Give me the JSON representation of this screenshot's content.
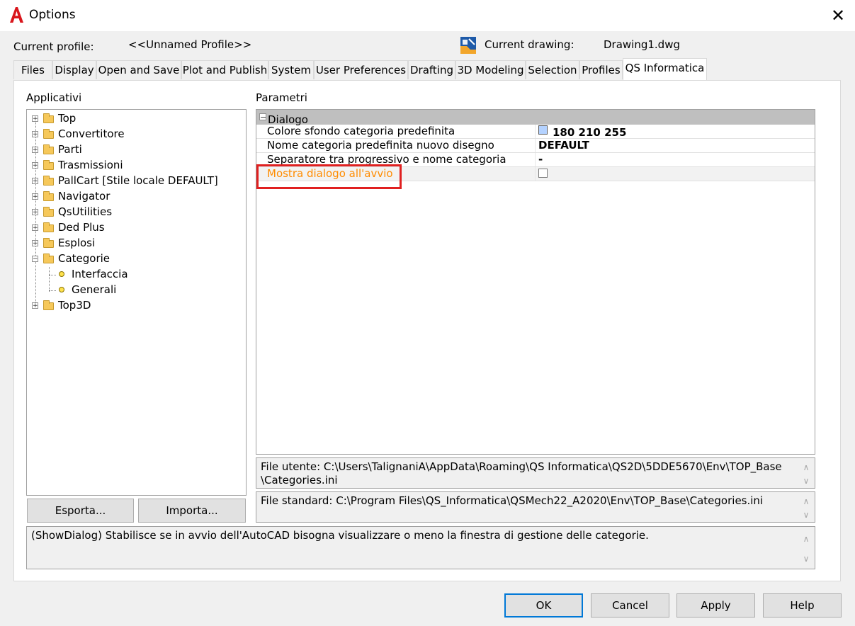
{
  "window": {
    "title": "Options",
    "close_glyph": "✕",
    "logo_letter": "A"
  },
  "profile": {
    "label": "Current profile:",
    "value": "<<Unnamed Profile>>"
  },
  "drawing": {
    "label": "Current drawing:",
    "value": "Drawing1.dwg"
  },
  "tabs": [
    {
      "label": "Files"
    },
    {
      "label": "Display"
    },
    {
      "label": "Open and Save"
    },
    {
      "label": "Plot and Publish"
    },
    {
      "label": "System"
    },
    {
      "label": "User Preferences"
    },
    {
      "label": "Drafting"
    },
    {
      "label": "3D Modeling"
    },
    {
      "label": "Selection"
    },
    {
      "label": "Profiles"
    },
    {
      "label": "QS Informatica"
    }
  ],
  "left": {
    "heading": "Applicativi",
    "tree": [
      {
        "label": "Top"
      },
      {
        "label": "Convertitore"
      },
      {
        "label": "Parti"
      },
      {
        "label": "Trasmissioni"
      },
      {
        "label": "PallCart [Stile locale DEFAULT]"
      },
      {
        "label": "Navigator"
      },
      {
        "label": "QsUtilities"
      },
      {
        "label": "Ded Plus"
      },
      {
        "label": "Esplosi"
      },
      {
        "label": "Categorie"
      },
      {
        "label": "Interfaccia"
      },
      {
        "label": "Generali"
      },
      {
        "label": "Top3D"
      }
    ],
    "export_button": "Esporta...",
    "import_button": "Importa..."
  },
  "right": {
    "heading": "Parametri",
    "group": {
      "toggle": "−",
      "label": "Dialogo"
    },
    "rows": [
      {
        "name": "Colore sfondo categoria predefinita",
        "value": "180 210 255"
      },
      {
        "name": "Nome categoria predefinita nuovo disegno",
        "value": "DEFAULT"
      },
      {
        "name": "Separatore tra progressivo e nome categoria",
        "value": "-"
      },
      {
        "name": "Mostra dialogo all'avvio",
        "value": ""
      }
    ],
    "swatch_color": "#b4d2ff",
    "highlight_color": "#e02020",
    "selected_text_color": "#ff8c00"
  },
  "files": {
    "user_line1": "File utente: C:\\Users\\TalignaniA\\AppData\\Roaming\\QS Informatica\\QS2D\\5DDE5670\\Env\\TOP_Base",
    "user_line2": "\\Categories.ini",
    "standard": "File standard: C:\\Program Files\\QS_Informatica\\QSMech22_A2020\\Env\\TOP_Base\\Categories.ini"
  },
  "description": "(ShowDialog) Stabilisce se in avvio dell'AutoCAD bisogna visualizzare o meno la finestra di gestione delle categorie.",
  "scroll": {
    "up": "∧",
    "down": "∨"
  },
  "footer": {
    "ok": "OK",
    "cancel": "Cancel",
    "apply": "Apply",
    "help": "Help"
  }
}
